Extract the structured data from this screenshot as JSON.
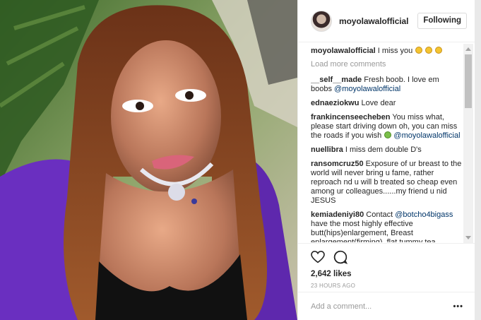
{
  "post": {
    "username": "moyolawalofficial",
    "follow_label": "Following",
    "caption_user": "moyolawalofficial",
    "caption_text": "I miss you",
    "load_more": "Load more comments",
    "likes": "2,642 likes",
    "time": "23 HOURS AGO",
    "add_comment_placeholder": "Add a comment...",
    "more_label": "•••"
  },
  "comments": [
    {
      "user": "__self__made",
      "text": "Fresh boob. I love em boobs ",
      "mention": "@moyolawalofficial"
    },
    {
      "user": "ednaeziokwu",
      "text": "Love dear"
    },
    {
      "user": "frankincenseecheben",
      "text": "You miss what, please start driving down oh, you can miss the roads if you wish ",
      "mention": "@moyolawalofficial"
    },
    {
      "user": "nuellibra",
      "text": "I miss dem double D's"
    },
    {
      "user": "ransomcruz50",
      "text": "Exposure of ur breast to the world will never bring u fame, rather reproach nd u will b treated so cheap even among ur colleagues......my friend u nid JESUS"
    },
    {
      "user": "kemiadeniyi80",
      "text": "Contact ",
      "mention": "@botcho4bigass",
      "text_after": " have the most highly effective butt(hips)enlargement, Breast enlargement(firming), flat tummy tea"
    }
  ],
  "icons": {
    "like": "heart-icon",
    "comment": "comment-icon"
  },
  "colors": {
    "accent_mention": "#003569",
    "dress": "#6a2fc0",
    "hair": "#8a4a22"
  }
}
